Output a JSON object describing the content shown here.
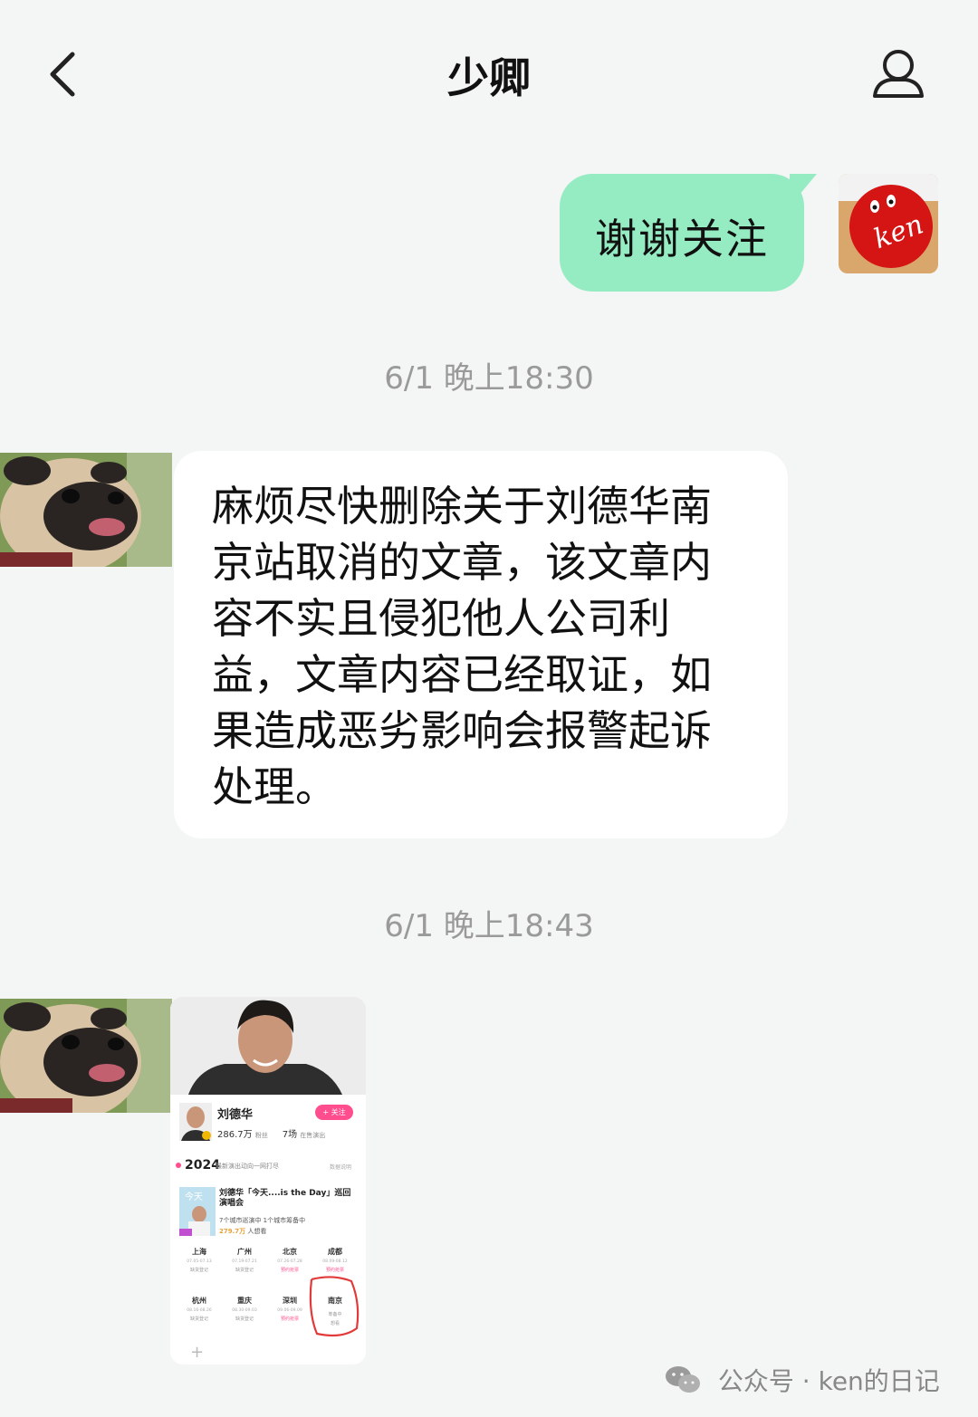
{
  "header": {
    "title": "少卿",
    "back_icon": "chevron-left-icon",
    "profile_icon": "person-icon"
  },
  "messages": {
    "outgoing": {
      "text": "谢谢关注"
    },
    "time1": "6/1 晚上18:30",
    "incoming": {
      "text": "麻烦尽快删除关于刘德华南京站取消的文章，该文章内容不实且侵犯他人公司利益，文章内容已经取证，如果造成恶劣影响会报警起诉处理。"
    },
    "time2": "6/1 晚上18:43"
  },
  "image_message": {
    "artist_name": "刘德华",
    "follow_label": "+ 关注",
    "fans": "286.7万",
    "fans_label": "粉丝",
    "shows": "7场",
    "shows_label": "在售演出",
    "year": "2024",
    "year_sub": "最新演出动向一网打尽",
    "year_note": "数据说明",
    "tour_title": "刘德华「今天....is the Day」巡回演唱会",
    "tour_info": "7个城市巡演中  1个城市筹备中",
    "want_num": "279.7万",
    "want_label": "人想看",
    "cities": [
      {
        "name": "上海",
        "date": "07.05-07.13",
        "status": "缺货登记"
      },
      {
        "name": "广州",
        "date": "07.19-07.21",
        "status": "缺货登记"
      },
      {
        "name": "北京",
        "date": "07.26-07.28",
        "status": "预约抢票"
      },
      {
        "name": "成都",
        "date": "08.09-08.12",
        "status": "预约抢票"
      },
      {
        "name": "杭州",
        "date": "08.16-08.26",
        "status": "缺货登记"
      },
      {
        "name": "重庆",
        "date": "08.30-09.03",
        "status": "缺货登记"
      },
      {
        "name": "深圳",
        "date": "09.06-09.09",
        "status": "预约抢票"
      },
      {
        "name": "南京",
        "date": "",
        "status": "筹备中",
        "extra": "想看"
      }
    ],
    "plus": "+"
  },
  "watermark": {
    "text": "公众号 · ken的日记",
    "icon": "wechat-icon"
  },
  "colors": {
    "background": "#f4f5f5",
    "outgoing_bubble": "#95ecc2",
    "incoming_bubble": "#ffffff",
    "timestamp": "#9a9a9a",
    "accent_pink": "#ff4d8d",
    "annotation_red": "#e23a3a"
  }
}
